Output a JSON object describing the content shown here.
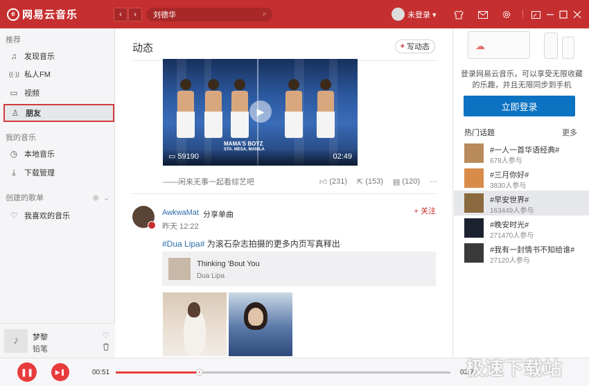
{
  "app": {
    "logo_mark": "e",
    "logo_text": "网易云音乐"
  },
  "topbar": {
    "back_icon": "‹",
    "forward_icon": "›",
    "search_value": "刘德华",
    "search_icon": "⌕",
    "user_label": "未登录 ▾",
    "icons": [
      "shirt-icon",
      "mail-icon",
      "gear-icon",
      "mini-mode-icon",
      "minimize-icon",
      "maximize-icon",
      "close-icon"
    ]
  },
  "sidebar": {
    "section_recommend": "推荐",
    "items": [
      {
        "label": "发现音乐",
        "icon": "♫"
      },
      {
        "label": "私人FM",
        "icon": "((·))"
      },
      {
        "label": "视频",
        "icon": "▭"
      },
      {
        "label": "朋友",
        "icon": "♙"
      }
    ],
    "section_my_music": "我的音乐",
    "my_items": [
      {
        "label": "本地音乐",
        "icon": "◷"
      },
      {
        "label": "下载管理",
        "icon": "⤓"
      }
    ],
    "section_playlist": "创建的歌单",
    "playlist_items": [
      {
        "label": "我喜欢的音乐",
        "icon": "♡"
      }
    ]
  },
  "now_playing": {
    "title": "梦黎",
    "artist": "铅笔"
  },
  "main": {
    "title": "动态",
    "write_label": "写动态",
    "post1": {
      "views": "59190",
      "duration": "02:49",
      "banner_line1": "MAMA'S BOYZ",
      "banner_line2": "STA. MESA, MANILA",
      "caption": "——闲来无事一起看综艺吧",
      "likes": "(231)",
      "shares": "(153)",
      "comments": "(120)",
      "more": "···"
    },
    "post2": {
      "user": "AwkwaMat",
      "action": "分享单曲",
      "time": "昨天 12:22",
      "follow": "+ 关注",
      "tag": "#Dua Lipa#",
      "text": " 为滚石杂志拍摄的更多内页写真释出",
      "song_title": "Thinking 'Bout You",
      "song_artist": "Dua Lipa"
    }
  },
  "rightp": {
    "login_desc": "登录网易云音乐，可以享受无限收藏的乐趣，并且无限同步到手机",
    "login_button": "立即登录",
    "hot_title": "热门话题",
    "more": "更多",
    "topics": [
      {
        "name": "#一人一首华语经典#",
        "count": "678人参与",
        "color": "#b98a5c",
        "highlight": false
      },
      {
        "name": "#三月你好#",
        "count": "3830人参与",
        "color": "#d98c4a",
        "highlight": false
      },
      {
        "name": "#早安世界#",
        "count": "163449人参与",
        "color": "#8a6a3e",
        "highlight": true
      },
      {
        "name": "#晚安时光#",
        "count": "271470人参与",
        "color": "#1c2230",
        "highlight": false
      },
      {
        "name": "#我有一封情书不知给谁#",
        "count": "27120人参与",
        "color": "#3a3a3a",
        "highlight": false
      }
    ]
  },
  "player": {
    "time_current": "00:51",
    "time_total": "03:2",
    "progress": 0.25,
    "play_icon": "❚❚",
    "next_icon": "▶❚"
  },
  "watermark": "极速下载站"
}
